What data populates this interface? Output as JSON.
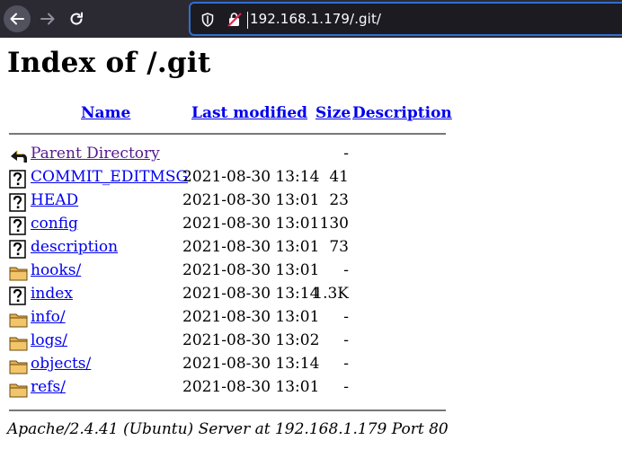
{
  "browser": {
    "url": "192.168.1.179/.git/"
  },
  "page": {
    "title": "Index of /.git",
    "headers": {
      "name": "Name",
      "last_modified": "Last modified",
      "size": "Size",
      "description": "Description"
    },
    "rows": [
      {
        "name": "Parent Directory",
        "date": "",
        "size": "-",
        "icon": "back-icon"
      },
      {
        "name": "COMMIT_EDITMSG",
        "date": "2021-08-30 13:14",
        "size": "41",
        "icon": "unknown-file-icon"
      },
      {
        "name": "HEAD",
        "date": "2021-08-30 13:01",
        "size": "23",
        "icon": "unknown-file-icon"
      },
      {
        "name": "config",
        "date": "2021-08-30 13:01",
        "size": "130",
        "icon": "unknown-file-icon"
      },
      {
        "name": "description",
        "date": "2021-08-30 13:01",
        "size": "73",
        "icon": "unknown-file-icon"
      },
      {
        "name": "hooks/",
        "date": "2021-08-30 13:01",
        "size": "-",
        "icon": "folder-icon"
      },
      {
        "name": "index",
        "date": "2021-08-30 13:14",
        "size": "1.3K",
        "icon": "unknown-file-icon"
      },
      {
        "name": "info/",
        "date": "2021-08-30 13:01",
        "size": "-",
        "icon": "folder-icon"
      },
      {
        "name": "logs/",
        "date": "2021-08-30 13:02",
        "size": "-",
        "icon": "folder-icon"
      },
      {
        "name": "objects/",
        "date": "2021-08-30 13:14",
        "size": "-",
        "icon": "folder-icon"
      },
      {
        "name": "refs/",
        "date": "2021-08-30 13:01",
        "size": "-",
        "icon": "folder-icon"
      }
    ],
    "footer": "Apache/2.4.41 (Ubuntu) Server at 192.168.1.179 Port 80"
  },
  "colors": {
    "toolbar_bg": "#2b2a33",
    "url_focus_border": "#2f6fcf",
    "link": "#0000ee",
    "visited_link": "#551a8b"
  }
}
